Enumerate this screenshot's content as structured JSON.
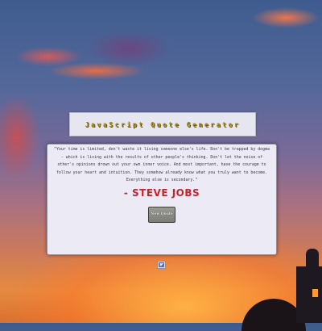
{
  "app": {
    "title": "JavaScript Quote Generator"
  },
  "quote": {
    "text": "\"Your time is limited, don't waste it living someone else's life. Don't be trapped by dogma - which is living with the results of other people's thinking. Don't let the noise of other's opinions drown out your own inner voice. And most important, have the courage to follow your heart and intuition. They somehow already know what you truly want to become. Everything else is secondary.\"",
    "author": "- STEVE JOBS"
  },
  "buttons": {
    "new_quote_label": "New Quote"
  },
  "icons": {
    "tweet": "twitter-icon"
  },
  "colors": {
    "title_text": "#a8891a",
    "author_text": "#c8222a",
    "panel_bg": "#eceaf5"
  }
}
